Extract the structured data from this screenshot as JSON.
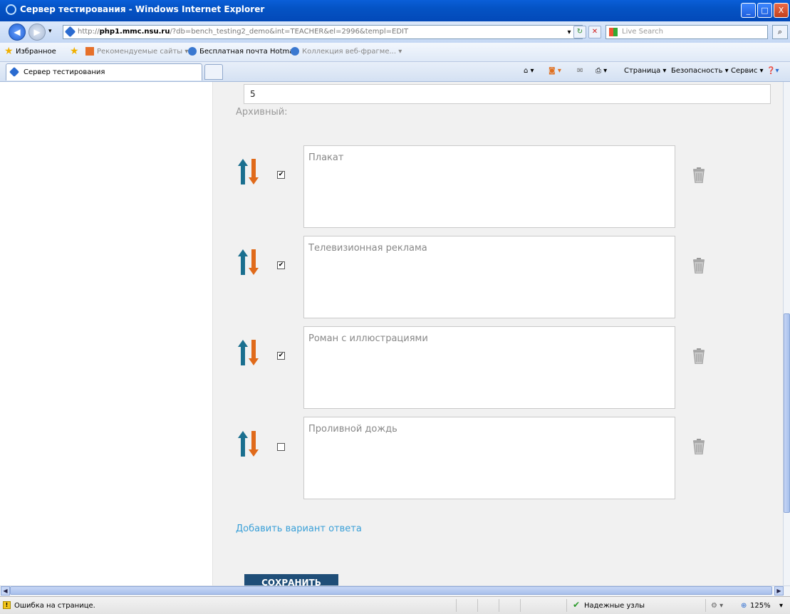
{
  "window": {
    "title": "Сервер тестирования - Windows Internet Explorer",
    "minimize": "_",
    "maximize": "□",
    "close": "X"
  },
  "address": {
    "url_prefix": "http://",
    "url_host": "php1.mmc.nsu.ru",
    "url_rest": "/?db=bench_testing2_demo&int=TEACHER&el=2996&templ=EDIT",
    "search_placeholder": "Live Search"
  },
  "favorites_bar": {
    "favorites_label": "Избранное",
    "items": [
      "Рекомендуемые сайты ▾",
      "Бесплатная почта Hotmail",
      "Коллекция веб-фрагме... ▾"
    ]
  },
  "tabs": {
    "active_tab": "Сервер тестирования",
    "commands": [
      "Страница ▾",
      "Безопасность ▾",
      "Сервис ▾"
    ]
  },
  "form": {
    "top_value": "5",
    "archive_label": "Архивный:",
    "answers": [
      {
        "text": "Плакат",
        "checked": true,
        "mark": "✔"
      },
      {
        "text": "Телевизионная реклама",
        "checked": true,
        "mark": "✔"
      },
      {
        "text": "Роман с иллюстрациями",
        "checked": true,
        "mark": "✔"
      },
      {
        "text": "Проливной дождь",
        "checked": false,
        "mark": ""
      }
    ],
    "add_answer_link": "Добавить вариант ответа",
    "save_button": "СОХРАНИТЬ"
  },
  "status": {
    "error_text": "Ошибка на странице.",
    "zone_text": "Надежные узлы",
    "zoom": "125%"
  },
  "colors": {
    "arrow_up": "#1a6f8f",
    "arrow_down": "#e06a1a",
    "link": "#3aa0d8",
    "save_bg": "#1f4e78"
  }
}
